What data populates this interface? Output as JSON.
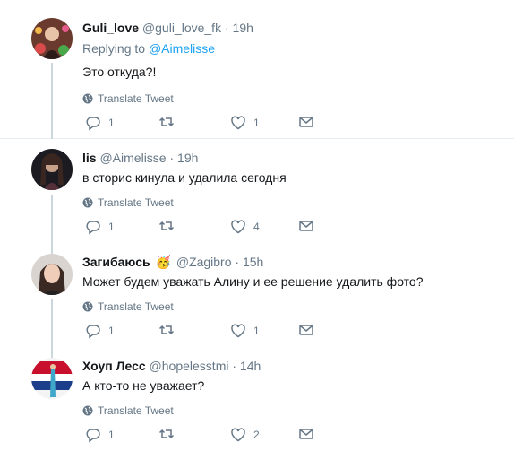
{
  "tweets": [
    {
      "name": "Guli_love",
      "handle": "@guli_love_fk",
      "time": "19h",
      "replying_prefix": "Replying to",
      "replying_to": "@Aimelisse",
      "text": "Это откуда?!",
      "translate": "Translate Tweet",
      "replies": "1",
      "retweets": "",
      "likes": "1"
    },
    {
      "name": "lis",
      "handle": "@Aimelisse",
      "time": "19h",
      "text": "в сторис кинула и удалила сегодня",
      "translate": "Translate Tweet",
      "replies": "1",
      "retweets": "",
      "likes": "4"
    },
    {
      "name": "Загибаюсь",
      "emoji": "🥳",
      "handle": "@Zagibro",
      "time": "15h",
      "text": "Может будем уважать Алину и ее решение удалить фото?",
      "translate": "Translate Tweet",
      "replies": "1",
      "retweets": "",
      "likes": "1"
    },
    {
      "name": "Хоуп Лесс",
      "handle": "@hopelesstmi",
      "time": "14h",
      "text": "А кто-то не уважает?",
      "translate": "Translate Tweet",
      "replies": "1",
      "retweets": "",
      "likes": "2"
    }
  ],
  "separator": "·",
  "icons": [
    "globe-icon",
    "reply-icon",
    "retweet-icon",
    "like-icon",
    "message-icon"
  ],
  "colors": {
    "text": "#14171a",
    "muted": "#657786",
    "link": "#1da1f2",
    "border": "#e6ecf0",
    "thread": "#ccd6dd"
  }
}
